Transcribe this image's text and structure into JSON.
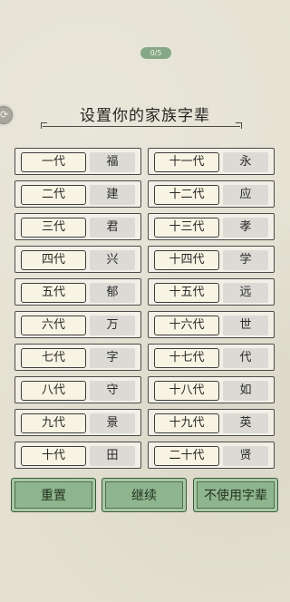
{
  "top_badge": "0/5",
  "side_icon": "refresh-icon",
  "title": "设置你的家族字辈",
  "rows_left": [
    {
      "gen": "一代",
      "char": "福"
    },
    {
      "gen": "二代",
      "char": "建"
    },
    {
      "gen": "三代",
      "char": "君"
    },
    {
      "gen": "四代",
      "char": "兴"
    },
    {
      "gen": "五代",
      "char": "郁"
    },
    {
      "gen": "六代",
      "char": "万"
    },
    {
      "gen": "七代",
      "char": "字"
    },
    {
      "gen": "八代",
      "char": "守"
    },
    {
      "gen": "九代",
      "char": "景"
    },
    {
      "gen": "十代",
      "char": "田"
    }
  ],
  "rows_right": [
    {
      "gen": "十一代",
      "char": "永"
    },
    {
      "gen": "十二代",
      "char": "应"
    },
    {
      "gen": "十三代",
      "char": "孝"
    },
    {
      "gen": "十四代",
      "char": "学"
    },
    {
      "gen": "十五代",
      "char": "远"
    },
    {
      "gen": "十六代",
      "char": "世"
    },
    {
      "gen": "十七代",
      "char": "代"
    },
    {
      "gen": "十八代",
      "char": "如"
    },
    {
      "gen": "十九代",
      "char": "英"
    },
    {
      "gen": "二十代",
      "char": "贤"
    }
  ],
  "buttons": {
    "reset": "重置",
    "continue": "继续",
    "no_generation": "不使用字辈"
  },
  "colors": {
    "background": "#e4e1d2",
    "button_green": "#8fb58f",
    "cell_grey": "#dbdad5"
  }
}
